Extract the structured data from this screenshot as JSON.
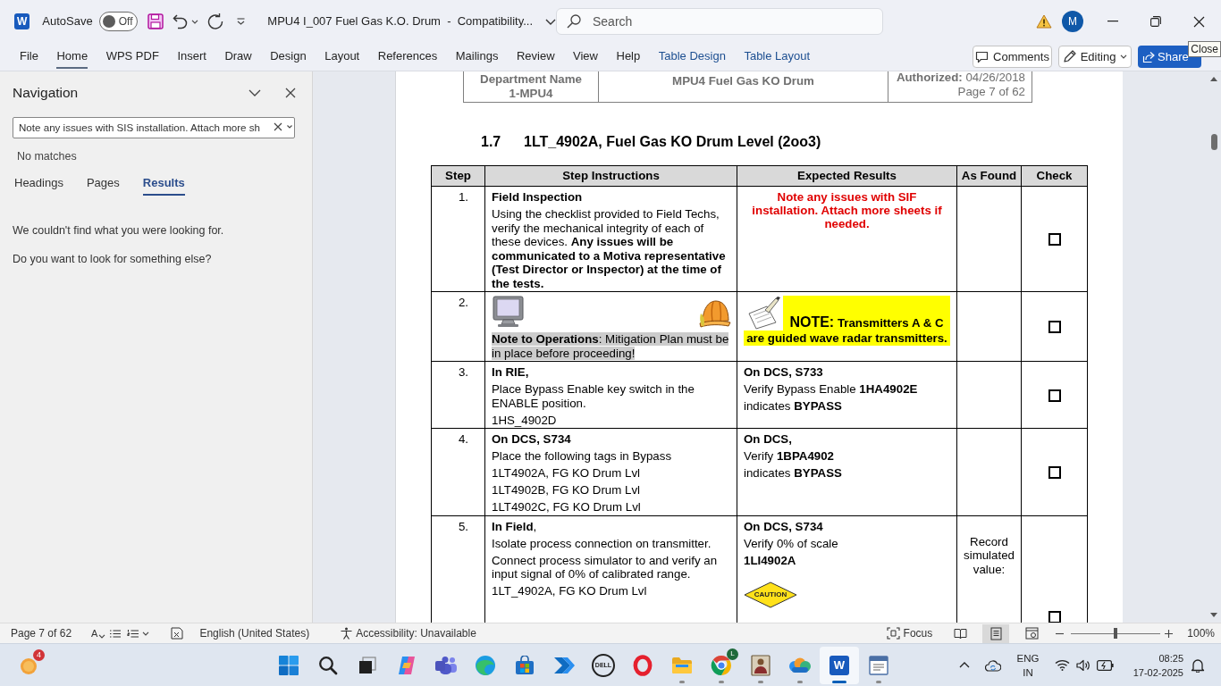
{
  "title_bar": {
    "app_logo": "W",
    "autosave": {
      "label": "AutoSave",
      "on": false,
      "state_label": "Off"
    },
    "document_title": "MPU4 I_007 Fuel Gas K.O. Drum  -  Compatibility...",
    "search": {
      "placeholder": "Search"
    },
    "avatar": "M"
  },
  "ribbon": {
    "tabs": [
      {
        "label": "File",
        "selected": false,
        "contextual": false
      },
      {
        "label": "Home",
        "selected": true,
        "contextual": false
      },
      {
        "label": "WPS PDF",
        "selected": false,
        "contextual": false
      },
      {
        "label": "Insert",
        "selected": false,
        "contextual": false
      },
      {
        "label": "Draw",
        "selected": false,
        "contextual": false
      },
      {
        "label": "Design",
        "selected": false,
        "contextual": false
      },
      {
        "label": "Layout",
        "selected": false,
        "contextual": false
      },
      {
        "label": "References",
        "selected": false,
        "contextual": false
      },
      {
        "label": "Mailings",
        "selected": false,
        "contextual": false
      },
      {
        "label": "Review",
        "selected": false,
        "contextual": false
      },
      {
        "label": "View",
        "selected": false,
        "contextual": false
      },
      {
        "label": "Help",
        "selected": false,
        "contextual": false
      },
      {
        "label": "Table Design",
        "selected": false,
        "contextual": true
      },
      {
        "label": "Table Layout",
        "selected": false,
        "contextual": true
      }
    ],
    "buttons": [
      {
        "kind": "comments",
        "label": "Comments"
      },
      {
        "kind": "editing",
        "label": "Editing"
      },
      {
        "kind": "share",
        "label": "Share"
      }
    ]
  },
  "tooltip": "Close",
  "navigation": {
    "title": "Navigation",
    "search": {
      "value": "Note any issues with SIS installation. Attach more sh"
    },
    "status": "No matches",
    "tabs": [
      {
        "label": "Headings",
        "selected": false
      },
      {
        "label": "Pages",
        "selected": false
      },
      {
        "label": "Results",
        "selected": true
      }
    ],
    "messages": [
      "We couldn't find what you were looking for.",
      "Do you want to look for something else?"
    ]
  },
  "document": {
    "header": {
      "department": [
        "Department Name",
        "1-MPU4"
      ],
      "title": "MPU4 Fuel Gas KO Drum",
      "authorized": "**Authorized:** 04/26/2018",
      "page": "Page 7 of 62"
    },
    "section": {
      "number": "1.7",
      "title": "1LT_4902A, Fuel Gas KO Drum Level (2oo3)"
    },
    "table": {
      "columns": [
        "Step",
        "Step Instructions",
        "Expected Results",
        "As Found",
        "Check"
      ],
      "rows": [
        {
          "step": "1.",
          "instructions": {
            "kind": "text",
            "paragraphs": [
              {
                "text": "Field Inspection",
                "bold": true,
                "highlighted": false
              },
              {
                "text": "Using the checklist provided to Field Techs, verify the mechanical integrity of each of these devices. **Any issues will be communicated to a Motiva representative (Test Director or Inspector) at the time of the tests.**",
                "bold": false,
                "highlighted": false
              }
            ]
          },
          "expected": {
            "kind": "warning",
            "text": "Note any issues with SIF installation. Attach more sheets if needed."
          },
          "checked": false
        },
        {
          "step": "2.",
          "instructions": {
            "kind": "illustrated",
            "paragraphs": [
              {
                "text": "**Note to Operations**: Mitigation Plan must be in place before proceeding!",
                "bold": false,
                "highlighted": true
              }
            ]
          },
          "expected": {
            "kind": "note",
            "label": "NOTE:",
            "text": "Transmitters A & C are guided wave radar transmitters."
          },
          "checked": false
        },
        {
          "step": "3.",
          "instructions": {
            "kind": "text",
            "paragraphs": [
              {
                "text": "In RIE,",
                "bold": true,
                "highlighted": false
              },
              {
                "text": "Place Bypass Enable key switch in the ENABLE position.",
                "bold": false,
                "highlighted": false
              },
              {
                "text": "1HS_4902D",
                "bold": false,
                "highlighted": false
              }
            ]
          },
          "expected": {
            "kind": "text",
            "paragraphs": [
              {
                "text": "On DCS, S733",
                "bold": true
              },
              {
                "text": "Verify Bypass Enable **1HA4902E**",
                "bold": false
              },
              {
                "text": "indicates **BYPASS**",
                "bold": false
              }
            ]
          },
          "checked": false
        },
        {
          "step": "4.",
          "instructions": {
            "kind": "text",
            "paragraphs": [
              {
                "text": "On DCS, S734",
                "bold": true,
                "highlighted": false
              },
              {
                "text": "Place the following tags in Bypass",
                "bold": false,
                "highlighted": false
              },
              {
                "text": "1LT4902A, FG KO Drum Lvl",
                "bold": false,
                "highlighted": false
              },
              {
                "text": "1LT4902B, FG KO Drum Lvl",
                "bold": false,
                "highlighted": false
              },
              {
                "text": "1LT4902C, FG KO Drum Lvl",
                "bold": false,
                "highlighted": false
              }
            ]
          },
          "expected": {
            "kind": "text",
            "paragraphs": [
              {
                "text": "On DCS,",
                "bold": true
              },
              {
                "text": "Verify **1BPA4902**",
                "bold": false
              },
              {
                "text": "indicates **BYPASS**",
                "bold": false
              }
            ]
          },
          "checked": false
        },
        {
          "step": "5.",
          "instructions": {
            "kind": "text",
            "paragraphs": [
              {
                "text": "**In Field**,",
                "bold": false,
                "highlighted": false
              },
              {
                "text": "Isolate process connection on transmitter.",
                "bold": false,
                "highlighted": false
              },
              {
                "text": "Connect process simulator to and verify an input signal of 0% of calibrated range.",
                "bold": false,
                "highlighted": false
              },
              {
                "text": "1LT_4902A, FG KO Drum Lvl",
                "bold": false,
                "highlighted": false
              }
            ]
          },
          "expected": {
            "kind": "caution",
            "paragraphs": [
              {
                "text": "On DCS, S734",
                "bold": true
              },
              {
                "text": "Verify 0% of scale",
                "bold": false
              },
              {
                "text": "1LI4902A",
                "bold": true
              }
            ],
            "sign": "CAUTION"
          },
          "as_found": "Record simulated value:",
          "checked": false
        }
      ]
    }
  },
  "status_bar": {
    "page": "Page 7 of 62",
    "format_glyph": "A",
    "language": "English (United States)",
    "accessibility": "Accessibility: Unavailable",
    "focus": "Focus",
    "views": [
      {
        "kind": "read",
        "selected": false
      },
      {
        "kind": "print",
        "selected": true
      },
      {
        "kind": "web",
        "selected": false
      }
    ],
    "zoom": {
      "level": 0.5,
      "label": "100%"
    }
  },
  "taskbar": {
    "weather_badge": "4",
    "apps": [
      {
        "kind": "start",
        "running": false,
        "selected": false
      },
      {
        "kind": "search",
        "running": false,
        "selected": false
      },
      {
        "kind": "taskview",
        "running": false,
        "selected": false
      },
      {
        "kind": "copilot",
        "running": false,
        "selected": false
      },
      {
        "kind": "teams",
        "running": false,
        "selected": false
      },
      {
        "kind": "edge",
        "running": false,
        "selected": false
      },
      {
        "kind": "store",
        "running": false,
        "selected": false
      },
      {
        "kind": "automate",
        "running": false,
        "selected": false
      },
      {
        "kind": "dell",
        "logo": "DELL",
        "running": false,
        "selected": false
      },
      {
        "kind": "opera",
        "running": false,
        "selected": false
      },
      {
        "kind": "explorer",
        "running": true,
        "selected": false
      },
      {
        "kind": "chrome",
        "badge": "L",
        "running": true,
        "selected": false
      },
      {
        "kind": "portrait",
        "running": true,
        "selected": false
      },
      {
        "kind": "clouds",
        "running": true,
        "selected": false
      },
      {
        "kind": "word",
        "logo": "W",
        "running": true,
        "selected": true
      },
      {
        "kind": "window",
        "running": true,
        "selected": false
      }
    ],
    "input_language": {
      "language": "ENG",
      "region": "IN"
    },
    "clock": {
      "time": "08:25",
      "date": "17-02-2025"
    }
  }
}
